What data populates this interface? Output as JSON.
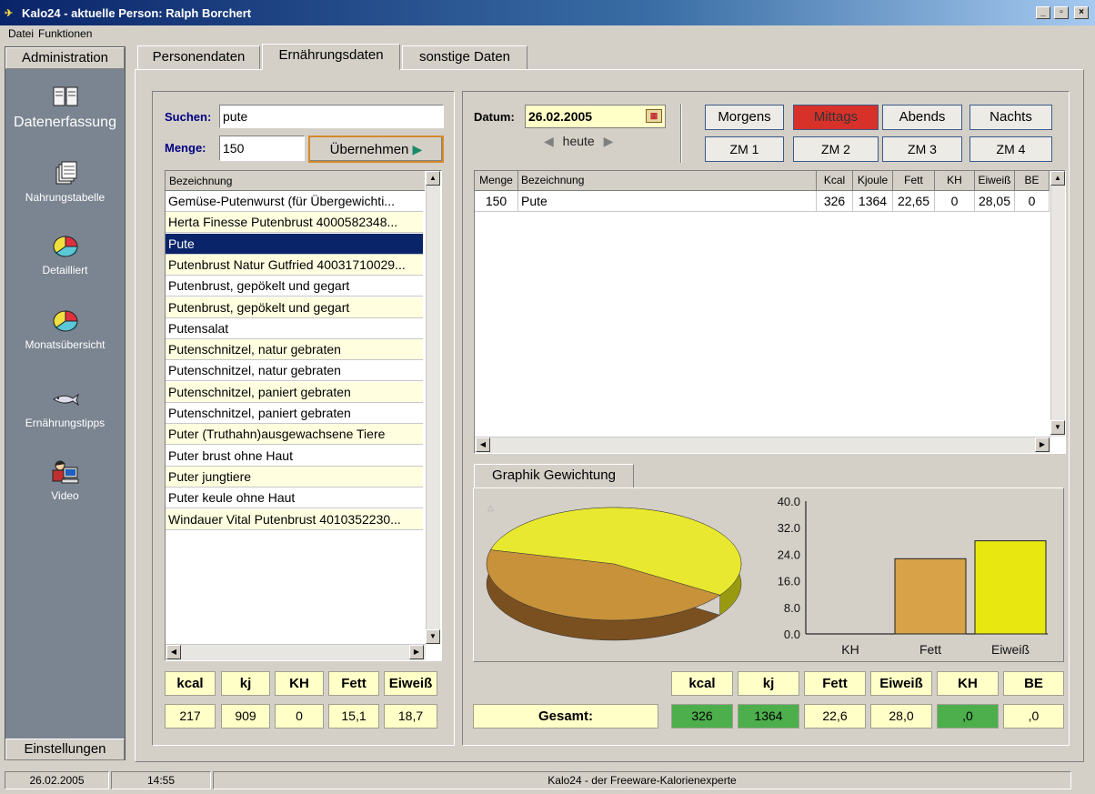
{
  "window": {
    "title": "Kalo24 - aktuelle Person: Ralph Borchert",
    "min": "_",
    "max": "▫",
    "close": "×"
  },
  "menu": [
    "Datei",
    "Funktionen"
  ],
  "sidebar": {
    "header": "Administration",
    "section": "Datenerfassung",
    "items": [
      "Nahrungstabelle",
      "Detailliert",
      "Monatsübersicht",
      "Ernährungstipps",
      "Video"
    ],
    "footer": "Einstellungen"
  },
  "tabs": [
    "Personendaten",
    "Ernährungsdaten",
    "sonstige Daten"
  ],
  "search": {
    "label": "Suchen:",
    "value": "pute",
    "menge_label": "Menge:",
    "menge_value": "150",
    "apply_label": "Übernehmen"
  },
  "foodlist": {
    "header": "Bezeichnung",
    "selected_index": 2,
    "items": [
      "Gemüse-Putenwurst  (für Übergewichti...",
      "Herta Finesse Putenbrust 4000582348...",
      "Pute",
      "Putenbrust Natur Gutfried 40031710029...",
      "Putenbrust, gepökelt und gegart",
      "Putenbrust, gepökelt und gegart",
      "Putensalat",
      "Putenschnitzel, natur gebraten",
      "Putenschnitzel, natur gebraten",
      "Putenschnitzel, paniert gebraten",
      "Putenschnitzel, paniert gebraten",
      "Puter (Truthahn)ausgewachsene Tiere",
      "Puter brust ohne Haut",
      "Puter jungtiere",
      "Puter keule ohne Haut",
      "Windauer Vital Putenbrust 4010352230..."
    ]
  },
  "left_summary": {
    "headers": [
      "kcal",
      "kj",
      "KH",
      "Fett",
      "Eiweiß"
    ],
    "values": [
      "217",
      "909",
      "0",
      "15,1",
      "18,7"
    ]
  },
  "date": {
    "label": "Datum:",
    "value": "26.02.2005",
    "today_label": "heute"
  },
  "meals": {
    "row1": [
      "Morgens",
      "Mittags",
      "Abends",
      "Nachts"
    ],
    "active": "Mittags",
    "row2": [
      "ZM 1",
      "ZM 2",
      "ZM 3",
      "ZM 4"
    ]
  },
  "entries": {
    "headers": [
      "Menge",
      "Bezeichnung",
      "Kcal",
      "Kjoule",
      "Fett",
      "KH",
      "Eiweiß",
      "BE"
    ],
    "rows": [
      [
        "150",
        "Pute",
        "326",
        "1364",
        "22,65",
        "0",
        "28,05",
        "0"
      ]
    ]
  },
  "graph_tab": "Graphik Gewichtung",
  "chart_data": [
    {
      "type": "pie",
      "values": [
        28.05,
        22.65,
        0
      ],
      "colors": [
        "#e8e830",
        "#c8923a",
        "#c8c8c8"
      ]
    },
    {
      "type": "bar",
      "categories": [
        "KH",
        "Fett",
        "Eiweiß"
      ],
      "values": [
        0,
        22.65,
        28.05
      ],
      "ylim": [
        0,
        40
      ],
      "yticks": [
        "40.0",
        "32.0",
        "24.0",
        "16.0",
        "8.0",
        "0.0"
      ]
    }
  ],
  "totals": {
    "label": "Gesamt:",
    "headers": [
      "kcal",
      "kj",
      "Fett",
      "Eiweiß",
      "KH",
      "BE"
    ],
    "values": [
      "326",
      "1364",
      "22,6",
      "28,0",
      ",0",
      ",0"
    ]
  },
  "status": {
    "date": "26.02.2005",
    "time": "14:55",
    "message": "Kalo24 - der Freeware-Kalorienexperte"
  },
  "colors": {
    "accent_red": "#d8312a",
    "green": "#4caf4c",
    "yellow": "#ffffc8",
    "selected": "#0a246a"
  }
}
